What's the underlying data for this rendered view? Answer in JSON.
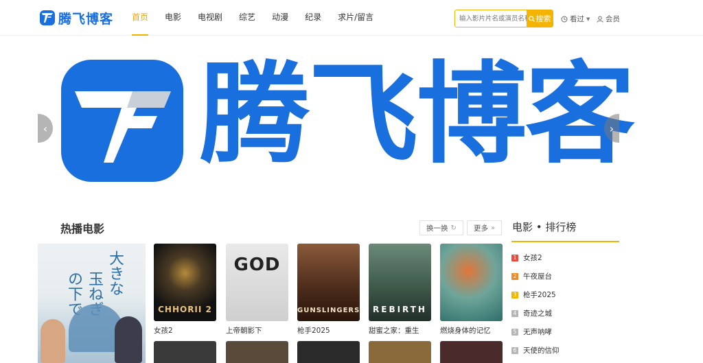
{
  "header": {
    "logo_text": "腾飞博客",
    "nav": [
      {
        "label": "首页",
        "active": true
      },
      {
        "label": "电影",
        "active": false
      },
      {
        "label": "电视剧",
        "active": false
      },
      {
        "label": "综艺",
        "active": false
      },
      {
        "label": "动漫",
        "active": false
      },
      {
        "label": "纪录",
        "active": false
      },
      {
        "label": "求片/留言",
        "active": false
      }
    ],
    "search_placeholder": "输入影片片名或演员名称",
    "search_button": "搜索",
    "history_label": "看过",
    "member_label": "会员"
  },
  "banner": {
    "text": "腾飞博客",
    "prev_icon": "chevron-left-icon",
    "next_icon": "chevron-right-icon"
  },
  "section": {
    "title": "热播电影",
    "refresh_label": "换一换",
    "more_label": "更多"
  },
  "featured_poster_text": [
    "大きな",
    "玉ねぎ",
    "の下で"
  ],
  "movies": [
    {
      "title": "女孩2",
      "poster_text": "CHHORII 2"
    },
    {
      "title": "上帝朝影下",
      "poster_text": "GOD"
    },
    {
      "title": "枪手2025",
      "poster_text": "GUNSLINGERS"
    },
    {
      "title": "甜蜜之家：重生",
      "poster_text": "REBIRTH"
    },
    {
      "title": "燃烧身体的记忆",
      "poster_text": ""
    }
  ],
  "ranking": {
    "title": "电影 • 排行榜",
    "items": [
      {
        "no": "1",
        "title": "女孩2"
      },
      {
        "no": "2",
        "title": "午夜屋台"
      },
      {
        "no": "3",
        "title": "枪手2025"
      },
      {
        "no": "4",
        "title": "奇迹之城"
      },
      {
        "no": "5",
        "title": "无声呐哮"
      },
      {
        "no": "6",
        "title": "天使的信仰"
      }
    ]
  },
  "colors": {
    "brand": "#1a6fde",
    "accent": "#f0b400",
    "rank_top": [
      "#e84a3c",
      "#f08a24",
      "#f5b400"
    ],
    "rank_rest": "#b5b5b5"
  }
}
